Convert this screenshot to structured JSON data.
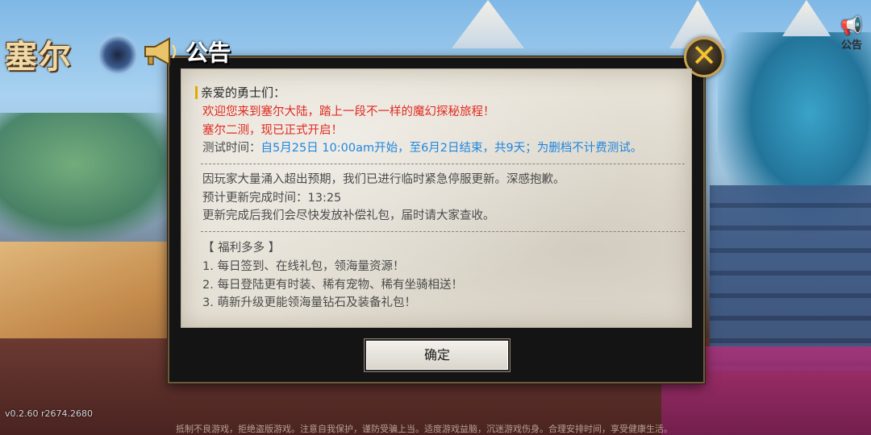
{
  "game": {
    "logo_text": "塞尔",
    "version": "v0.2.60 r2674.2680",
    "footer_note": "抵制不良游戏，拒绝盗版游戏。注意自我保护，谨防受骗上当。适度游戏益脑，沉迷游戏伤身。合理安排时间，享受健康生活。"
  },
  "top_right": {
    "notice_label": "公告"
  },
  "dialog": {
    "title": "公告",
    "greeting": "亲爱的勇士们：",
    "lines_red": [
      "欢迎您来到塞尔大陆，踏上一段不一样的魔幻探秘旅程！",
      "塞尔二测，现已正式开启！"
    ],
    "test_time_label": "测试时间：",
    "test_time_value": "自5月25日 10:00am开始，至6月2日结束，共9天；为删档不计费测试。",
    "maintenance_lines": [
      "因玩家大量涌入超出预期，我们已进行临时紧急停服更新。深感抱歉。",
      "预计更新完成时间：13:25",
      "更新完成后我们会尽快发放补偿礼包，届时请大家查收。"
    ],
    "benefits_header": "【 福利多多 】",
    "benefits": [
      "1. 每日签到、在线礼包，领海量资源！",
      "2. 每日登陆更有时装、稀有宠物、稀有坐骑相送！",
      "3. 萌新升级更能领海量钻石及装备礼包！"
    ],
    "confirm_label": "确定",
    "close_glyph": "✕"
  },
  "colors": {
    "red_text": "#e02a1f",
    "blue_text": "#1f86e0",
    "accent_gold": "#f4c531"
  }
}
